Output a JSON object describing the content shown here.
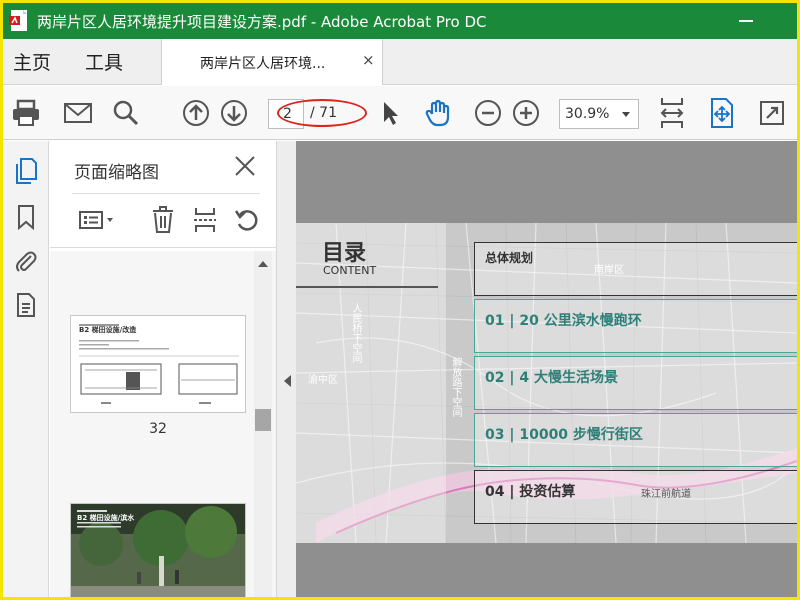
{
  "window": {
    "title": "两岸片区人居环境提升项目建设方案.pdf - Adobe Acrobat Pro DC"
  },
  "tabs": {
    "home": "主页",
    "tools": "工具",
    "document": "两岸片区人居环境...",
    "close_glyph": "×"
  },
  "toolbar": {
    "page_current": "2",
    "page_total": "/ 71",
    "zoom": "30.9%"
  },
  "thumbnails": {
    "panel_title": "页面缩略图",
    "items": [
      {
        "label": "32",
        "header": "B2 梯田设施/改造"
      },
      {
        "label": "",
        "header": "B2 梯田设施/滨水"
      }
    ]
  },
  "document": {
    "toc_title": "目录",
    "toc_subtitle": "CONTENT",
    "entries": [
      "总体规划",
      "01 | 20 公里滨水慢跑环",
      "02 | 4 大慢生活场景",
      "03 | 10000 步慢行街区",
      "04 | 投资估算"
    ],
    "map_labels": [
      "人民桥下空间",
      "解放路下空间",
      "渝中区",
      "南岸区",
      "珠江前航道"
    ]
  },
  "colors": {
    "titlebar": "#1a8a3a",
    "accent_teal": "#2f7f79",
    "annotation_red": "#d9261c",
    "active_icon_blue": "#1a73c8"
  }
}
